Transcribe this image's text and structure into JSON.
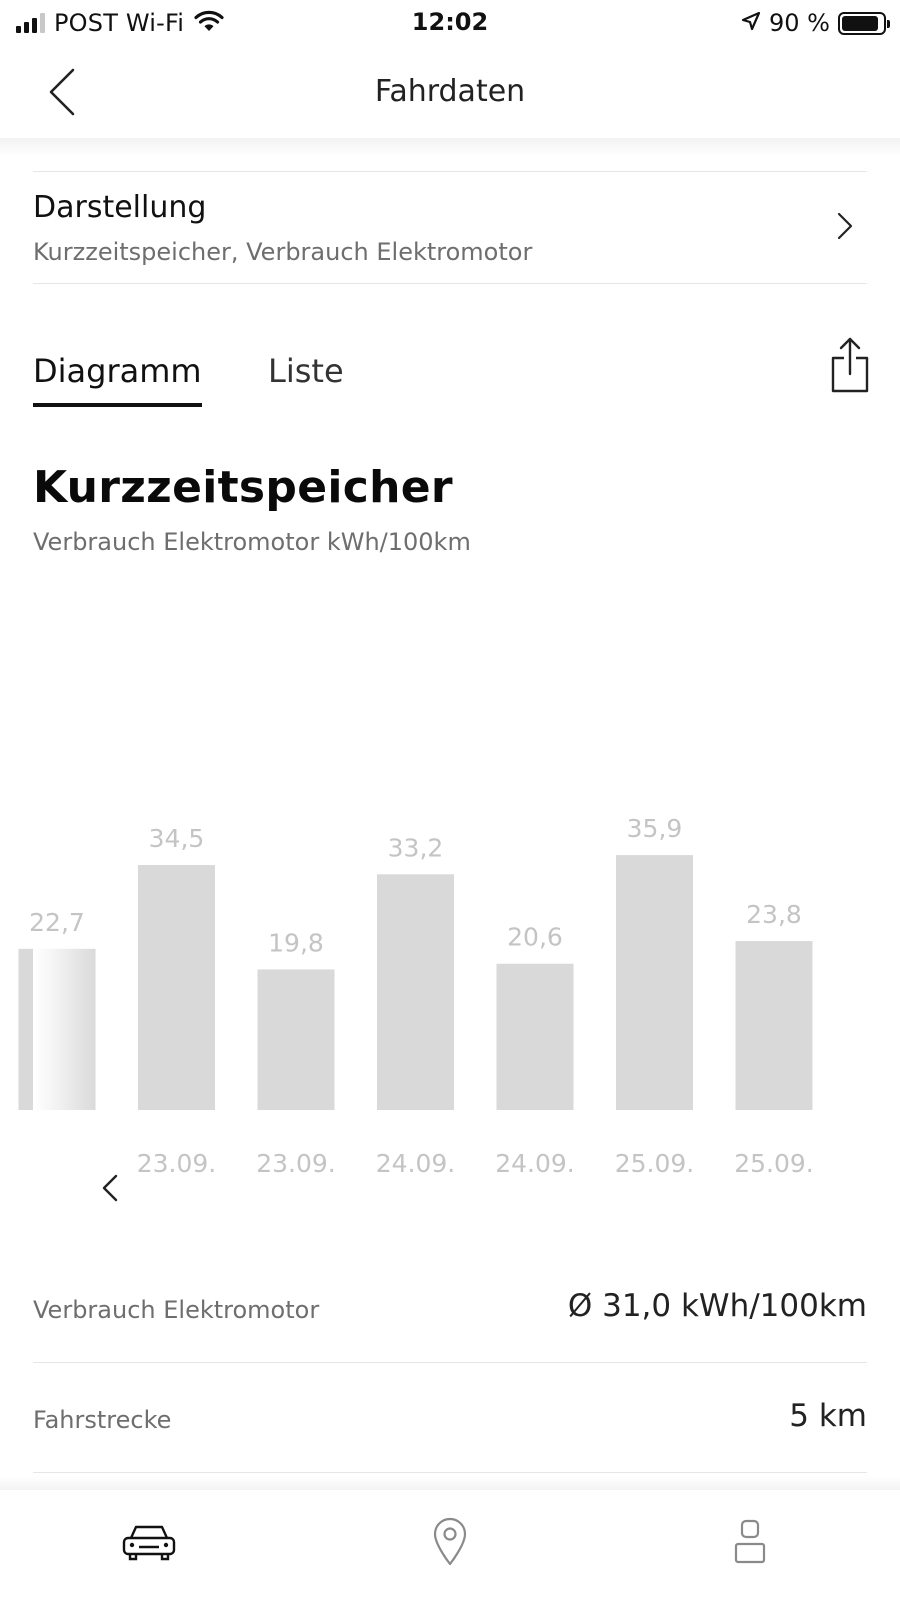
{
  "status_bar": {
    "carrier": "POST Wi-Fi",
    "time": "12:02",
    "battery_percent": "90 %",
    "battery_level": 0.9,
    "signal_bars_active": 3,
    "signal_bars_total": 4
  },
  "nav": {
    "title": "Fahrdaten",
    "back_icon": "chevron-left-icon"
  },
  "display_setting": {
    "title": "Darstellung",
    "value": "Kurzzeitspeicher, Verbrauch Elektromotor"
  },
  "tabs": [
    {
      "label": "Diagramm",
      "active": true
    },
    {
      "label": "Liste",
      "active": false
    }
  ],
  "share_icon": "share-icon",
  "chart_heading": {
    "title": "Kurzzeitspeicher",
    "subtitle": "Verbrauch Elektromotor kWh/100km"
  },
  "chart_data": {
    "type": "bar",
    "categories": [
      "",
      "23.09.",
      "23.09.",
      "24.09.",
      "24.09.",
      "25.09.",
      "25.09."
    ],
    "values": [
      22.7,
      34.5,
      19.8,
      33.2,
      20.6,
      35.9,
      23.8
    ],
    "value_labels": [
      "22,7",
      "34,5",
      "19,8",
      "33,2",
      "20,6",
      "35,9",
      "23,8"
    ],
    "ylabel": "kWh/100km",
    "bar_color": "#d9d9d9",
    "label_color": "#c4c4c4",
    "grid": false
  },
  "stats": [
    {
      "label": "Verbrauch Elektromotor",
      "value": "Ø 31,0 kWh/100km"
    },
    {
      "label": "Fahrstrecke",
      "value": "5 km"
    }
  ],
  "tab_bar": {
    "items": [
      {
        "icon": "car-icon",
        "active": true
      },
      {
        "icon": "map-pin-icon",
        "active": false
      },
      {
        "icon": "profile-icon",
        "active": false
      }
    ]
  },
  "colors": {
    "text_primary": "#111111",
    "text_secondary": "#6e6e6e",
    "divider": "#e6e6e6"
  }
}
